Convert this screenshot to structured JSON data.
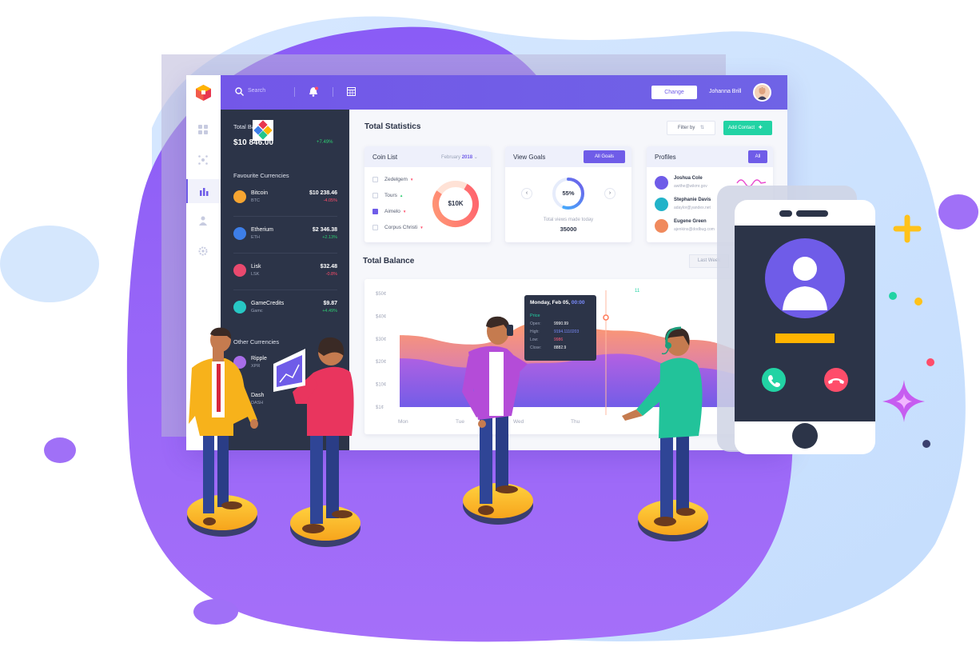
{
  "app": {
    "search_placeholder": "Search",
    "change_button": "Change",
    "user_name": "Johanna Brill"
  },
  "left_panel": {
    "total_balance_label": "Total Balance",
    "total_balance_value": "$10 846.00",
    "total_balance_change": "+7.49%",
    "favourite_title": "Favourite Currencies",
    "favourites": [
      {
        "name": "Bitcoin",
        "symbol": "BTC",
        "value": "$10 238.46",
        "change": "-4.05%",
        "color": "#f7a531"
      },
      {
        "name": "Etherium",
        "symbol": "ETH",
        "value": "$2 346.38",
        "change": "+2.13%",
        "color": "#3d7ee8"
      },
      {
        "name": "Lisk",
        "symbol": "LSK",
        "value": "$32.48",
        "change": "-0.8%",
        "color": "#e9496e"
      },
      {
        "name": "GameCredits",
        "symbol": "Gamc",
        "value": "$9.87",
        "change": "+4.49%",
        "color": "#27c7c4"
      }
    ],
    "other_title": "Other Currencies",
    "others": [
      {
        "name": "Ripple",
        "symbol": "XPR",
        "color": "#a86de8"
      },
      {
        "name": "Dash",
        "symbol": "DASH",
        "color": "#3d7ee8"
      }
    ]
  },
  "main": {
    "total_statistics_title": "Total Statistics",
    "filter_by_label": "Filter by",
    "add_contact_label": "Add Contact",
    "coin_list": {
      "title": "Coin List",
      "period": "February",
      "year": "2018",
      "donut_label": "$10K",
      "items": [
        {
          "label": "Zedelgem",
          "checked": false,
          "trend": "down"
        },
        {
          "label": "Tours",
          "checked": false,
          "trend": "up"
        },
        {
          "label": "Aimelo",
          "checked": true,
          "trend": "down"
        },
        {
          "label": "Corpus Christi",
          "checked": false,
          "trend": "down"
        }
      ]
    },
    "view_goals": {
      "title": "View Goals",
      "button": "All Goals",
      "percent": "55%",
      "percent_value": 0.55,
      "caption": "Total views made today",
      "views": "35000"
    },
    "profiles": {
      "title": "Profiles",
      "button": "All",
      "people": [
        {
          "name": "Joshua Cole",
          "email": "awithe@wikmr.gov"
        },
        {
          "name": "Stephanie Davis",
          "email": "adaylor@yandex.net"
        },
        {
          "name": "Eugene Green",
          "email": "ajenkins@dodbug.com"
        }
      ]
    },
    "total_balance_title": "Total Balance",
    "last_week_label": "Last Week",
    "chart_tooltip": {
      "date": "Monday, Feb 05,",
      "time": "00:00",
      "price_label": "Price",
      "rows": [
        {
          "label": "Open:",
          "value": "9990.99",
          "color": "#ffffff"
        },
        {
          "label": "High:",
          "value": "9194.1110203",
          "color": "#7b8cff"
        },
        {
          "label": "Low:",
          "value": "9986",
          "color": "#ff5c7a"
        },
        {
          "label": "Close:",
          "value": "8882.9",
          "color": "#ffffff"
        }
      ]
    },
    "chart_marker": "11"
  },
  "chart_data": {
    "type": "area",
    "categories": [
      "Mon",
      "Tue",
      "Wed",
      "Thu"
    ],
    "y_tick_labels": [
      "$50¢",
      "$40¢",
      "$30¢",
      "$20¢",
      "$10¢",
      "$1¢"
    ],
    "ylim": [
      1,
      50
    ],
    "series": [
      {
        "values": [
          32,
          28,
          38,
          34,
          30,
          24
        ]
      },
      {
        "values": [
          22,
          18,
          20,
          24,
          18,
          14
        ]
      }
    ]
  },
  "colors": {
    "brand": "#6f5ce8",
    "sidebar_dark": "#2c3448",
    "positive": "#2ecc71",
    "negative": "#ff4d6a",
    "accent_green": "#22d3a4"
  }
}
